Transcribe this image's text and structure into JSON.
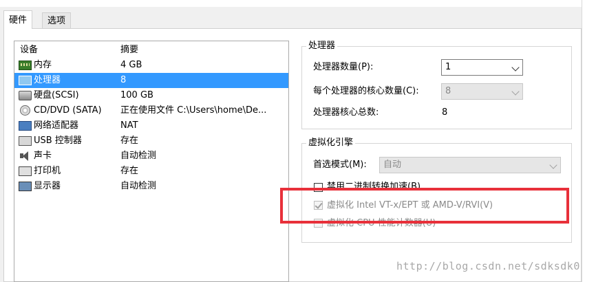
{
  "tabs": [
    {
      "label": "硬件"
    },
    {
      "label": "选项"
    }
  ],
  "device_list": {
    "header": {
      "device": "设备",
      "summary": "摘要"
    },
    "rows": [
      {
        "device": "内存",
        "summary": "4 GB",
        "icon": "memory-icon"
      },
      {
        "device": "处理器",
        "summary": "8",
        "icon": "cpu-icon",
        "selected": true
      },
      {
        "device": "硬盘(SCSI)",
        "summary": "100 GB",
        "icon": "hard-disk-icon"
      },
      {
        "device": "CD/DVD (SATA)",
        "summary": "正在使用文件 C:\\Users\\home\\De...",
        "icon": "cd-dvd-icon"
      },
      {
        "device": "网络适配器",
        "summary": "NAT",
        "icon": "network-adapter-icon"
      },
      {
        "device": "USB 控制器",
        "summary": "存在",
        "icon": "usb-icon"
      },
      {
        "device": "声卡",
        "summary": "自动检测",
        "icon": "speaker-icon"
      },
      {
        "device": "打印机",
        "summary": "存在",
        "icon": "printer-icon"
      },
      {
        "device": "显示器",
        "summary": "自动检测",
        "icon": "monitor-icon"
      }
    ]
  },
  "processor": {
    "title": "处理器",
    "count_label": "处理器数量(P):",
    "count_value": "1",
    "cores_label": "每个处理器的核心数量(C):",
    "cores_value": "8",
    "total_label": "处理器核心总数:",
    "total_value": "8"
  },
  "virtualization": {
    "title": "虚拟化引擎",
    "mode_label": "首选模式(M):",
    "mode_value": "自动",
    "opt1": "禁用二进制转换加速(B)",
    "opt2": "虚拟化 Intel VT-x/EPT 或 AMD-V/RVI(V)",
    "opt3": "虚拟化 CPU 性能计数器(U)"
  },
  "watermark": "http://blog.csdn.net/sdksdk0",
  "colors": {
    "selection": "#3399ff",
    "highlight_box": "#e8303a"
  }
}
